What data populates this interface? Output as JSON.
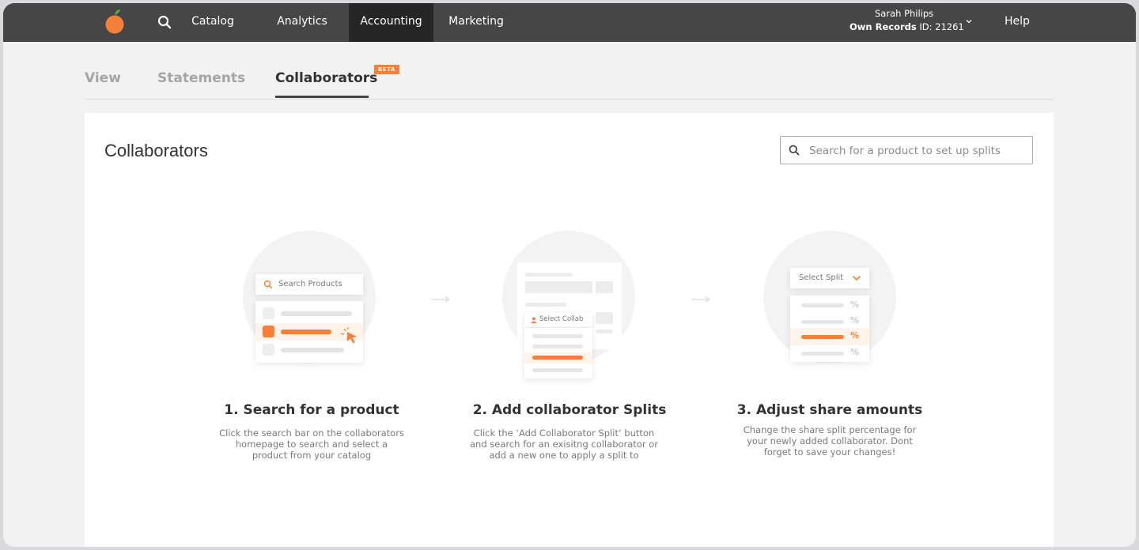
{
  "nav": {
    "items": [
      {
        "label": "Catalog",
        "active": false
      },
      {
        "label": "Analytics",
        "active": false
      },
      {
        "label": "Accounting",
        "active": true
      },
      {
        "label": "Marketing",
        "active": false
      }
    ],
    "user_name": "Sarah Philips",
    "record_label": "Own Records",
    "record_id": "ID: 21261",
    "help_label": "Help"
  },
  "tabs": [
    {
      "label": "View",
      "active": false
    },
    {
      "label": "Statements",
      "active": false
    },
    {
      "label": "Collaborators",
      "active": true
    }
  ],
  "beta_badge": "BETA",
  "card": {
    "title": "Collaborators",
    "search_placeholder": "Search for a product to set up splits"
  },
  "steps": [
    {
      "title": "1. Search for a product",
      "description": "Click the search bar on the collaborators homepage to search and select a product from your catalog",
      "mini_label": "Search Products"
    },
    {
      "title": "2. Add collaborator Splits",
      "description": "Click the ‘Add Collaborator Split’ button and search for an exisitng collaborator or add a new one to apply a split to",
      "mini_label": "Select Collab"
    },
    {
      "title": "3. Adjust share amounts",
      "description": "Change the share split percentage for your newly added collaborator. Dont forget to save your changes!",
      "mini_label": "Select Split",
      "percent_symbol": "%"
    }
  ],
  "colors": {
    "accent": "#f5803a",
    "nav_bg": "#464646",
    "nav_active_bg": "#262626"
  }
}
